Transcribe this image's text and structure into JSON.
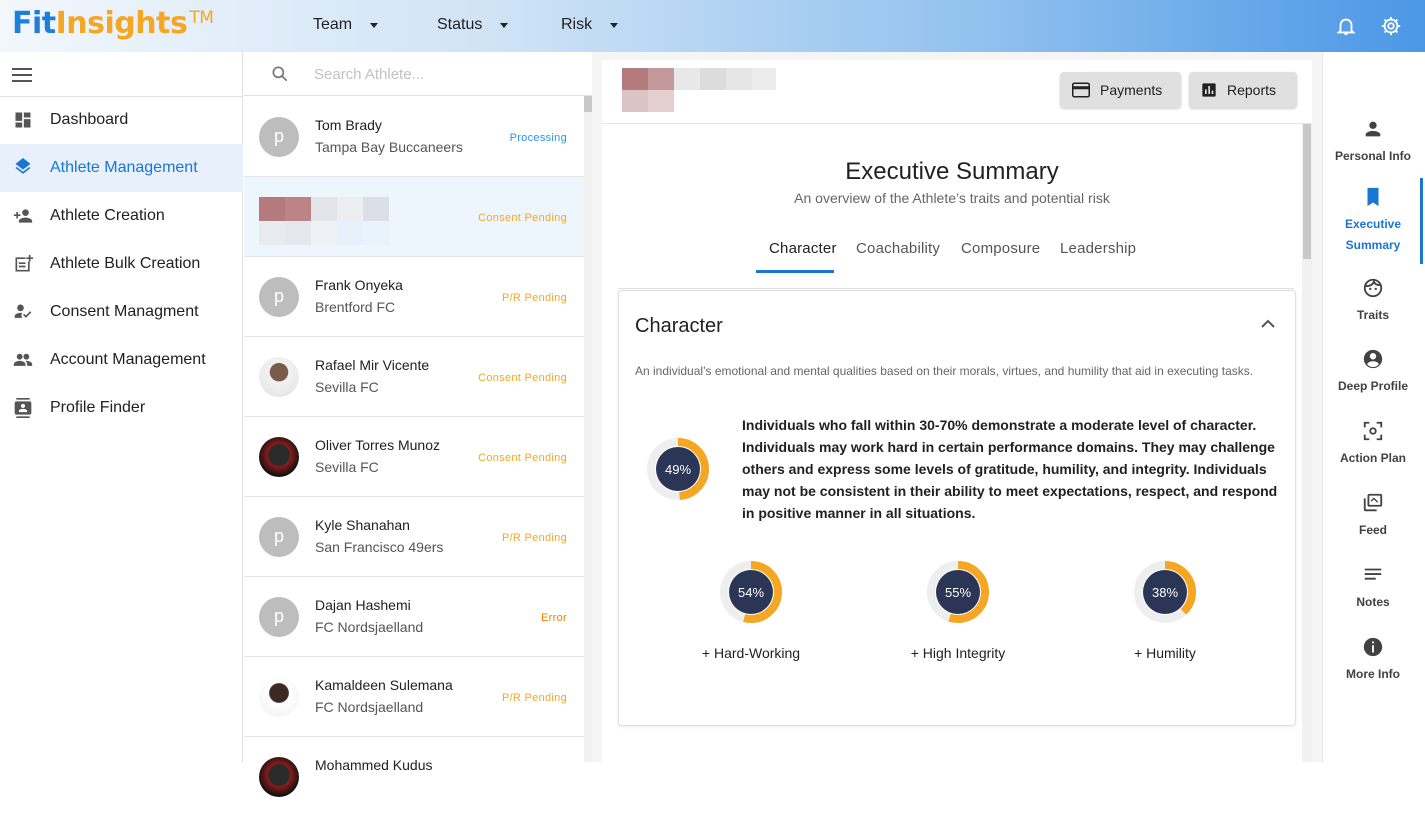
{
  "app": {
    "logo_fit": "Fit",
    "logo_insights": "Insights",
    "logo_tm": "TM"
  },
  "topnav": [
    {
      "label": "Team"
    },
    {
      "label": "Status"
    },
    {
      "label": "Risk"
    }
  ],
  "sidebar": {
    "items": [
      {
        "label": "Dashboard",
        "icon": "dashboard-icon"
      },
      {
        "label": "Athlete Management",
        "icon": "layers-icon",
        "active": true
      },
      {
        "label": "Athlete Creation",
        "icon": "person-add-icon"
      },
      {
        "label": "Athlete Bulk Creation",
        "icon": "post-add-icon"
      },
      {
        "label": "Consent Managment",
        "icon": "how-to-reg-icon"
      },
      {
        "label": "Account Management",
        "icon": "group-icon"
      },
      {
        "label": "Profile Finder",
        "icon": "contact-card-icon"
      }
    ]
  },
  "search": {
    "placeholder": "Search Athlete..."
  },
  "athletes": [
    {
      "name": "Tom Brady",
      "team": "Tampa Bay Buccaneers",
      "status": "Processing",
      "avatar": "p"
    },
    {
      "name": "",
      "team": "",
      "status": "Consent Pending",
      "avatar": ""
    },
    {
      "name": "Frank Onyeka",
      "team": "Brentford FC",
      "status": "P/R Pending",
      "avatar": "p"
    },
    {
      "name": "Rafael Mir Vicente",
      "team": "Sevilla FC",
      "status": "Consent Pending",
      "avatar": ""
    },
    {
      "name": "Oliver Torres Munoz",
      "team": "Sevilla FC",
      "status": "Consent Pending",
      "avatar": ""
    },
    {
      "name": "Kyle Shanahan",
      "team": "San Francisco 49ers",
      "status": "P/R Pending",
      "avatar": "p"
    },
    {
      "name": "Dajan Hashemi",
      "team": "FC Nordsjaelland",
      "status": "Error",
      "avatar": "p"
    },
    {
      "name": "Kamaldeen Sulemana",
      "team": "FC Nordsjaelland",
      "status": "P/R Pending",
      "avatar": ""
    },
    {
      "name": "Mohammed Kudus",
      "team": "",
      "status": "",
      "avatar": ""
    }
  ],
  "header": {
    "payments_label": "Payments",
    "reports_label": "Reports"
  },
  "summary": {
    "title": "Executive Summary",
    "subtitle": "An overview of the Athlete’s traits and potential risk",
    "tabs": [
      {
        "label": "Character"
      },
      {
        "label": "Coachability"
      },
      {
        "label": "Composure"
      },
      {
        "label": "Leadership"
      }
    ],
    "active_tab": "Character",
    "card": {
      "title": "Character",
      "description": "An individual’s emotional and mental qualities based on their morals, virtues, and humility that aid in executing tasks.",
      "score": 49,
      "score_label": "49%",
      "interpretation": "Individuals who fall within 30-70% demonstrate a moderate level of character. Individuals may work hard in certain performance domains. They may challenge others and express some levels of gratitude, humility, and integrity. Individuals may not be consistent in their ability to meet expectations, respect, and respond in positive manner in all situations.",
      "traits": [
        {
          "label": "+ Hard-Working",
          "value": 54,
          "value_label": "54%"
        },
        {
          "label": "+ High Integrity",
          "value": 55,
          "value_label": "55%"
        },
        {
          "label": "+ Humility",
          "value": 38,
          "value_label": "38%"
        }
      ]
    }
  },
  "rail": {
    "items": [
      {
        "label": "Personal Info",
        "icon": "person-icon"
      },
      {
        "label": "Executive Summary",
        "icon": "bookmark-icon",
        "active": true
      },
      {
        "label": "Traits",
        "icon": "face-icon"
      },
      {
        "label": "Deep Profile",
        "icon": "account-circle-icon"
      },
      {
        "label": "Action Plan",
        "icon": "center-focus-icon"
      },
      {
        "label": "Feed",
        "icon": "library-icon"
      },
      {
        "label": "Notes",
        "icon": "notes-icon"
      },
      {
        "label": "More Info",
        "icon": "info-icon"
      }
    ]
  },
  "colors": {
    "accent": "#1976d2",
    "orange": "#f5a623",
    "donut_core": "#2b3556",
    "processing": "#2196f3"
  }
}
